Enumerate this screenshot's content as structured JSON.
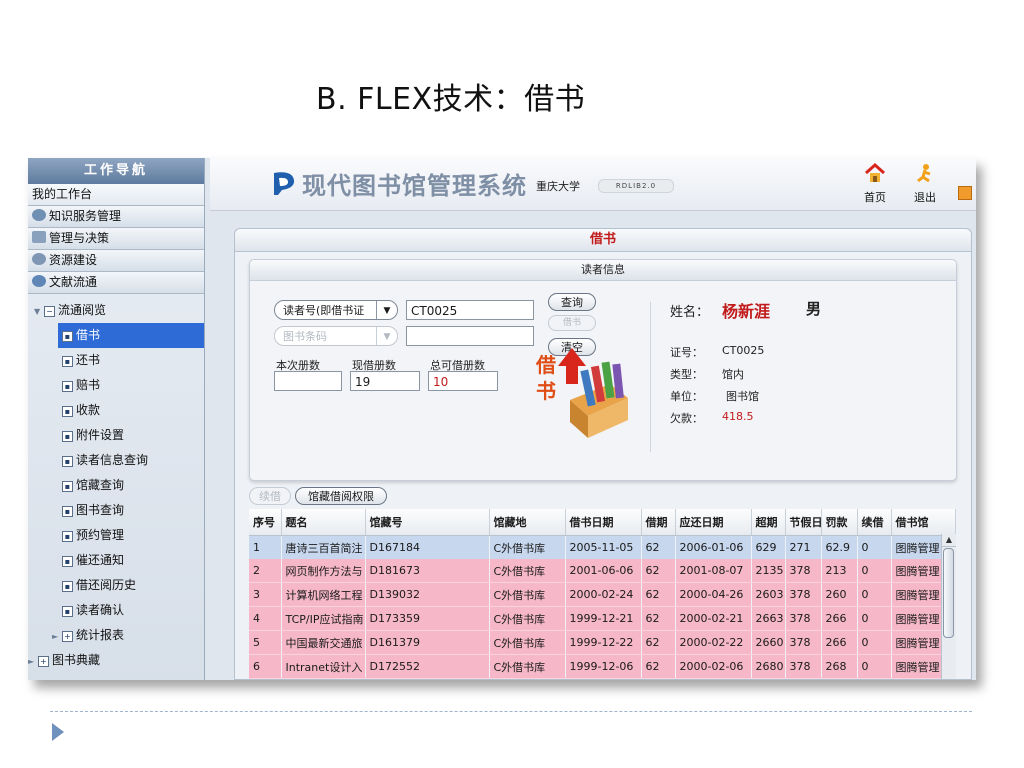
{
  "slide": {
    "title": "B. FLEX技术：借书"
  },
  "sidebar": {
    "header": "工作导航",
    "sections": [
      "我的工作台",
      "知识服务管理",
      "管理与决策",
      "资源建设",
      "文献流通"
    ],
    "tree": {
      "group": "流通阅览",
      "items": [
        "借书",
        "还书",
        "赔书",
        "收款",
        "附件设置",
        "读者信息查询",
        "馆藏查询",
        "图书查询",
        "预约管理",
        "催还通知",
        "借还阅历史",
        "读者确认"
      ],
      "selected": "借书",
      "stats": "统计报表",
      "collection": "图书典藏"
    }
  },
  "header": {
    "system_title": "现代图书馆管理系统",
    "university": "重庆大学",
    "version": "RDLIB2.0",
    "home_label": "首页",
    "logout_label": "退出"
  },
  "panel": {
    "title": "借书",
    "reader_info_title": "读者信息",
    "reader_type_select": "读者号(即借书证",
    "reader_id_value": "CT0025",
    "barcode_select": "图书条码",
    "barcode_value": "",
    "query_button": "查询",
    "borrow_button": "借书",
    "clear_button": "清空",
    "count_labels": {
      "this_time": "本次册数",
      "current": "现借册数",
      "total": "总可借册数"
    },
    "count_values": {
      "this_time": "",
      "current": "19",
      "total": "10"
    },
    "books_caption_1": "借",
    "books_caption_2": "书",
    "reader": {
      "name_label": "姓名：",
      "name": "杨新涯",
      "gender": "男",
      "card_label": "证号：",
      "card": "CT0025",
      "type_label": "类型：",
      "type": "馆内",
      "unit_label": "单位：",
      "unit": "图书馆",
      "debt_label": "欠款：",
      "debt": "418.5"
    },
    "renew_button": "续借",
    "permission_button": "馆藏借阅权限"
  },
  "table": {
    "columns": [
      "序号",
      "题名",
      "馆藏号",
      "馆藏地",
      "借书日期",
      "借期",
      "应还日期",
      "超期",
      "节假日",
      "罚款",
      "续借",
      "借书馆"
    ],
    "rows": [
      [
        "1",
        "唐诗三百首简注",
        "D167184",
        "C外借书库",
        "2005-11-05",
        "62",
        "2006-01-06",
        "629",
        "271",
        "62.9",
        "0",
        "图腾管理"
      ],
      [
        "2",
        "网页制作方法与",
        "D181673",
        "C外借书库",
        "2001-06-06",
        "62",
        "2001-08-07",
        "2135",
        "378",
        "213",
        "0",
        "图腾管理"
      ],
      [
        "3",
        "计算机网络工程",
        "D139032",
        "C外借书库",
        "2000-02-24",
        "62",
        "2000-04-26",
        "2603",
        "378",
        "260",
        "0",
        "图腾管理"
      ],
      [
        "4",
        "TCP/IP应试指南",
        "D173359",
        "C外借书库",
        "1999-12-21",
        "62",
        "2000-02-21",
        "2663",
        "378",
        "266",
        "0",
        "图腾管理"
      ],
      [
        "5",
        "中国最新交通旅",
        "D161379",
        "C外借书库",
        "1999-12-22",
        "62",
        "2000-02-22",
        "2660",
        "378",
        "266",
        "0",
        "图腾管理"
      ],
      [
        "6",
        "Intranet设计入",
        "D172552",
        "C外借书库",
        "1999-12-06",
        "62",
        "2000-02-06",
        "2680",
        "378",
        "268",
        "0",
        "图腾管理"
      ]
    ]
  },
  "colors": {
    "accent_red": "#c21b1b",
    "selection_blue": "#2f6bd6",
    "overdue_pink": "#f6b8c9",
    "first_row_blue": "#c7d7ee"
  }
}
